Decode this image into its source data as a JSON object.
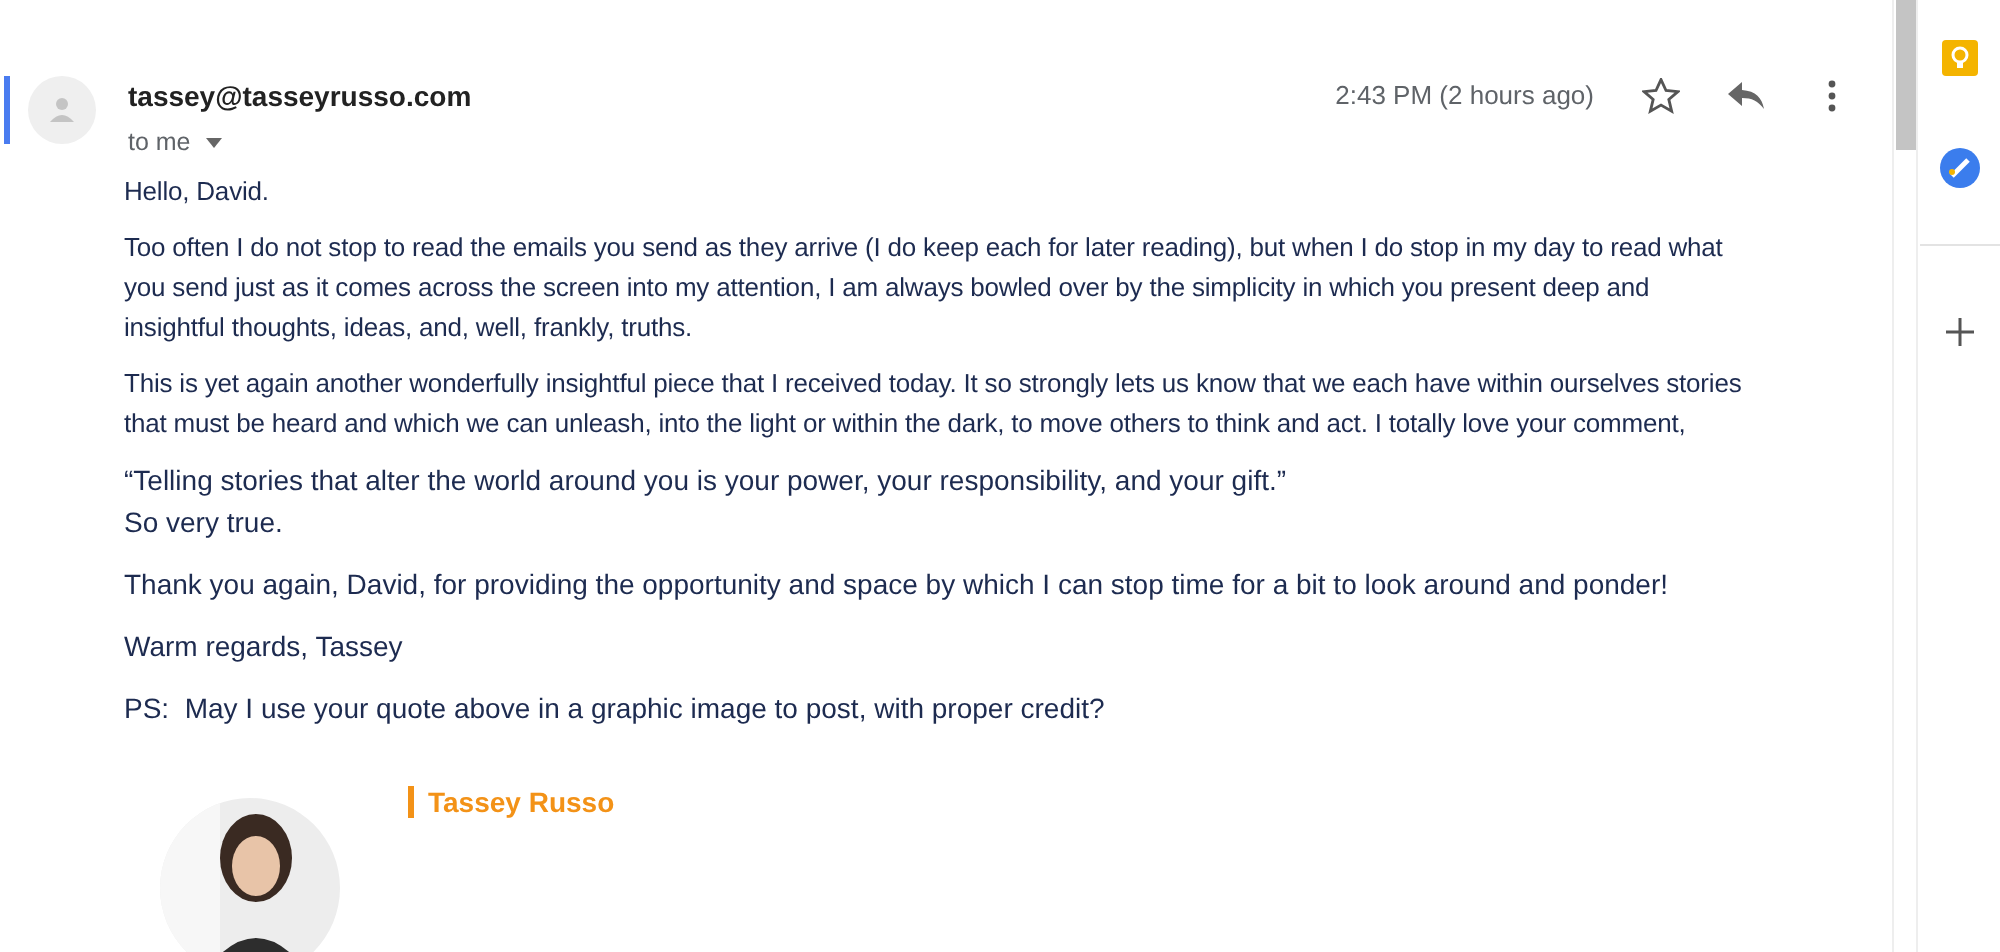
{
  "message": {
    "sender": "tassey@tasseyrusso.com",
    "recipient": "to me",
    "time": "2:43 PM (2 hours ago)",
    "starred": false
  },
  "body": [
    {
      "kind": "narrow",
      "text": "Hello, David."
    },
    {
      "kind": "narrow",
      "text": "Too often I do not stop to read the emails you send as they arrive (I do keep each for later reading), but when I do stop in my day to read what you send just as it comes across the screen into my attention, I am always bowled over by the simplicity in which you present deep and insightful thoughts, ideas, and, well, frankly, truths."
    },
    {
      "kind": "narrow",
      "text": "This is yet again another wonderfully insightful piece that I received today. It so strongly lets us know that we each have within ourselves stories that must be heard and which we can unleash, into the light or within the dark, to move others to think and act. I totally love your comment,"
    },
    {
      "kind": "plain",
      "lines": [
        "“Telling stories that alter the world around you is your power, your responsibility, and your gift.”",
        "So very true."
      ]
    },
    {
      "kind": "plain",
      "text": "Thank you again, David, for providing the opportunity and space by which I can stop time for a bit to look around and ponder!"
    },
    {
      "kind": "plain",
      "text": "Warm regards, Tassey"
    },
    {
      "kind": "plain",
      "text": "PS:  May I use your quote above in a graphic image to post, with proper credit?"
    }
  ],
  "signature": {
    "name": "Tassey Russo"
  }
}
